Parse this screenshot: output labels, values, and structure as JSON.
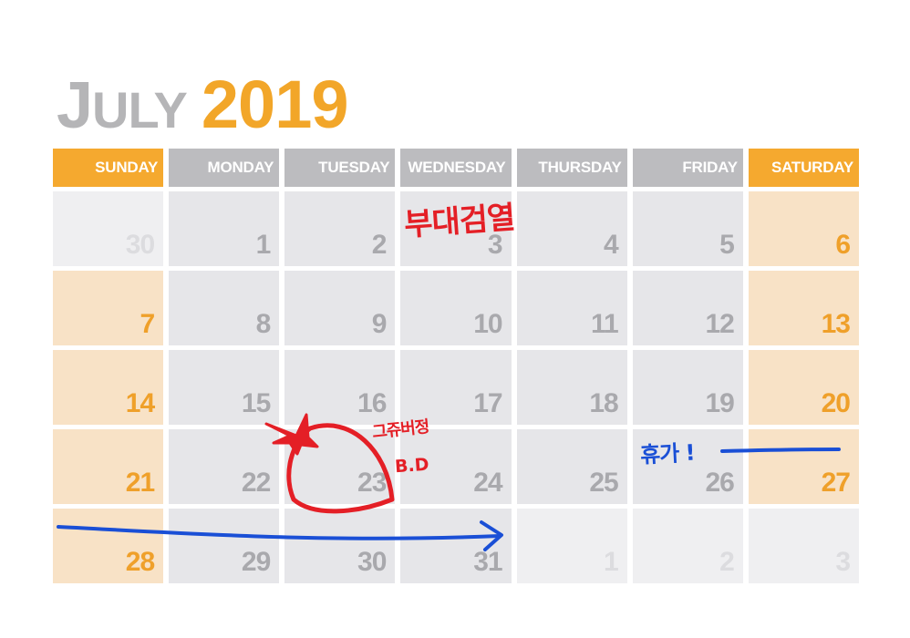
{
  "title": {
    "month_cap": "J",
    "month_rest": "ULY",
    "year": "2019"
  },
  "weekdays": [
    "SUNDAY",
    "MONDAY",
    "TUESDAY",
    "WEDNESDAY",
    "THURSDAY",
    "FRIDAY",
    "SATURDAY"
  ],
  "weeks": [
    [
      "30",
      "1",
      "2",
      "3",
      "4",
      "5",
      "6"
    ],
    [
      "7",
      "8",
      "9",
      "10",
      "11",
      "12",
      "13"
    ],
    [
      "14",
      "15",
      "16",
      "17",
      "18",
      "19",
      "20"
    ],
    [
      "21",
      "22",
      "23",
      "24",
      "25",
      "26",
      "27"
    ],
    [
      "28",
      "29",
      "30",
      "31",
      "1",
      "2",
      "3"
    ]
  ],
  "annotations": {
    "event_note": "부대검열",
    "birthday_name": "그쥬버정",
    "birthday_tag": "B.D",
    "vacation_note": "휴가 !"
  },
  "colors": {
    "accent": "#f5a92f",
    "header_gray": "#bcbcbf",
    "cell_gray": "#e6e6e9",
    "weekend_cell": "#f8e2c6",
    "marker_red": "#e41f26",
    "marker_blue": "#1a4fd6"
  }
}
